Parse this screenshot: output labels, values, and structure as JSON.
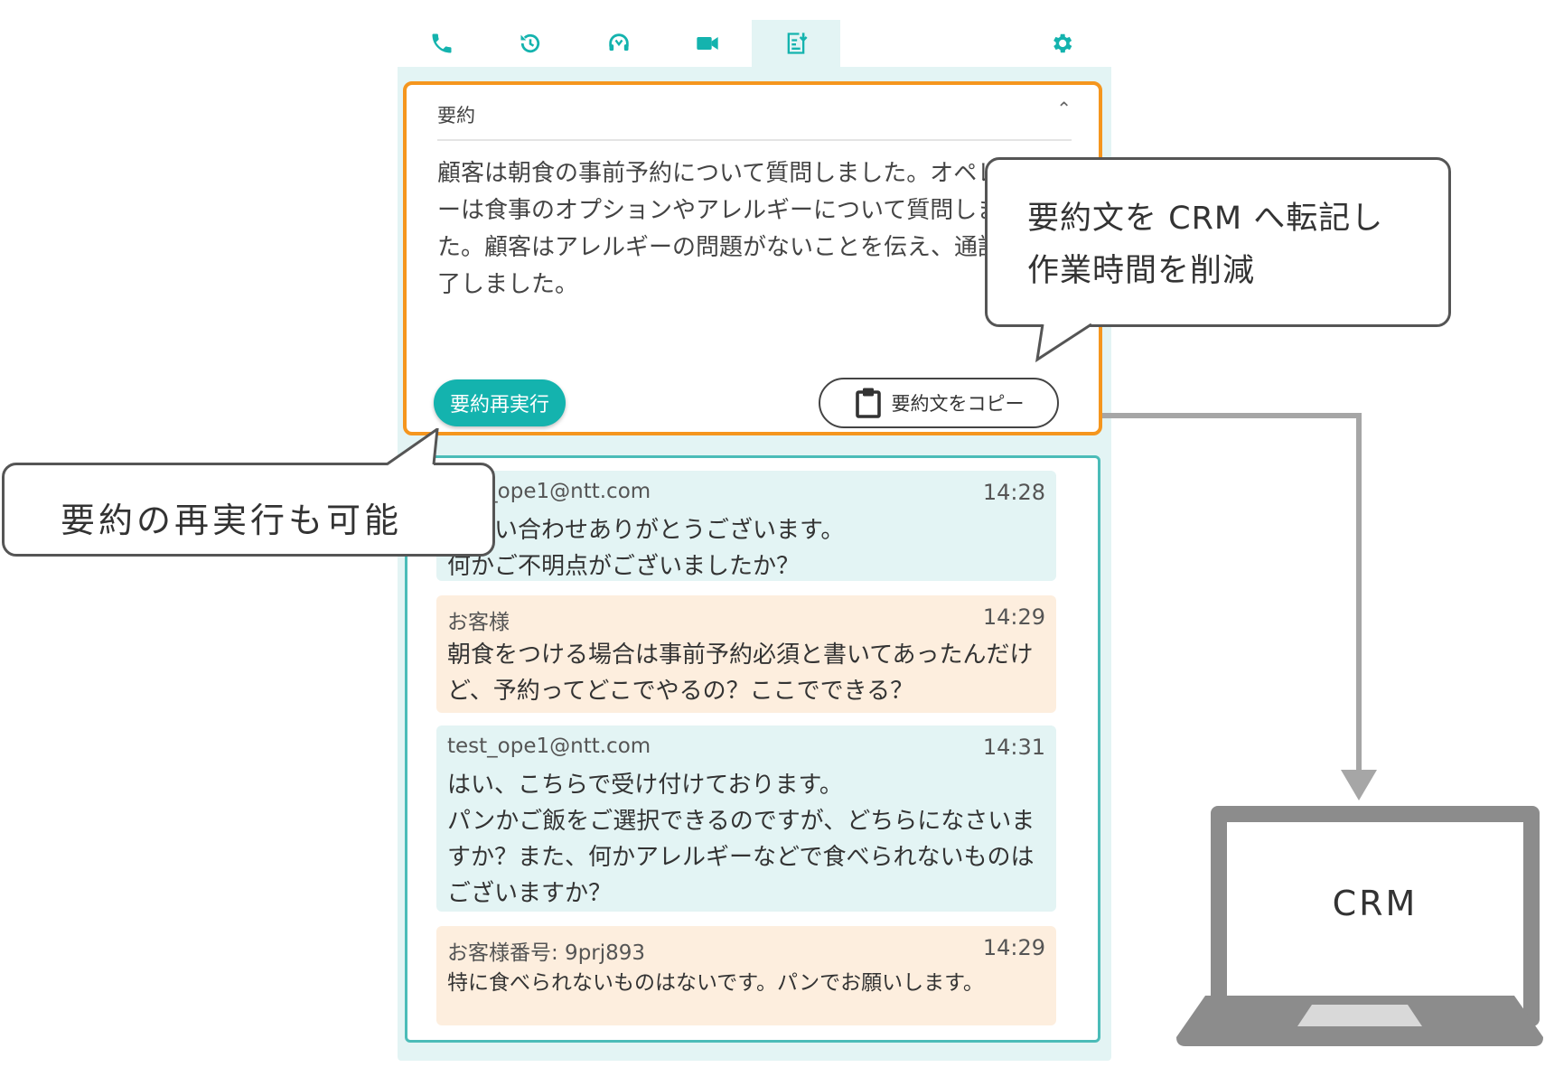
{
  "tabs": [
    {
      "icon": "phone-icon",
      "active": false
    },
    {
      "icon": "history-icon",
      "active": false
    },
    {
      "icon": "headset-icon",
      "active": false
    },
    {
      "icon": "video-icon",
      "active": false
    },
    {
      "icon": "summary-doc-icon",
      "active": true
    },
    {
      "icon": "gear-icon",
      "active": false
    }
  ],
  "summary": {
    "title": "要約",
    "text": "顧客は朝食の事前予約について質問しました。オペレーターは食事のオプションやアレルギーについて質問しました。顧客はアレルギーの問題がないことを伝え、通話が終了しました。",
    "rerun_label": "要約再実行",
    "copy_label": "要約文をコピー"
  },
  "messages": [
    {
      "role": "operator",
      "sender": "test_ope1@ntt.com",
      "time": "14:28",
      "text": "お問い合わせありがとうございます。\n何かご不明点がございましたか？"
    },
    {
      "role": "customer",
      "sender": "お客様",
      "time": "14:29",
      "text": "朝食をつける場合は事前予約必須と書いてあったんだけど、予約ってどこでやるの？ここでできる？"
    },
    {
      "role": "operator",
      "sender": "test_ope1@ntt.com",
      "time": "14:31",
      "text": "はい、こちらで受け付けております。\nパンかご飯をご選択できるのですが、どちらになさいますか？また、何かアレルギーなどで食べられないものはございますか？"
    },
    {
      "role": "customer",
      "sender": "お客様番号: 9prj893",
      "time": "14:29",
      "text": "特に食べられないものはないです。パンでお願いします。"
    }
  ],
  "callouts": {
    "crm_transfer": "要約文を CRM へ転記し\n作業時間を削減",
    "rerun_possible": "要約の再実行も可能"
  },
  "crm": {
    "label": "CRM"
  },
  "colors": {
    "accent": "#14b3ae",
    "panel_bg": "#e3f4f4",
    "highlight_border": "#f5961e",
    "operator_bubble": "#e3f4f4",
    "customer_bubble": "#fdeede",
    "laptop": "#8c8c8c",
    "connector": "#a6a6a6"
  }
}
